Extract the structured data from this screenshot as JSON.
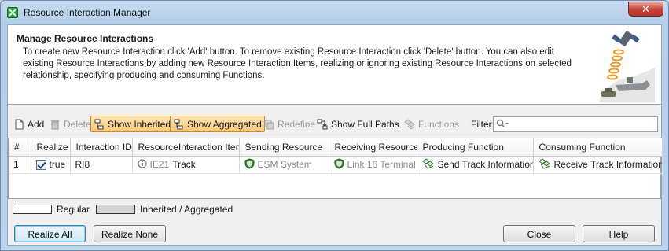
{
  "window": {
    "title": "Resource Interaction Manager",
    "close_glyph": "✕"
  },
  "header": {
    "title": "Manage Resource Interactions",
    "description": "To create new Resource Interaction click 'Add' button. To remove existing Resource Interaction click 'Delete' button. You can also edit existing Resource Interactions by adding new Resource Interaction Items, realizing or ignoring existing Resource Interactions on selected relationship, specifying producing and consuming Functions."
  },
  "toolbar": {
    "add": "Add",
    "delete": "Delete",
    "show_inherited": "Show Inherited",
    "show_aggregated": "Show Aggregated",
    "redefine": "Redefine",
    "show_full_paths": "Show Full Paths",
    "functions": "Functions",
    "filter_label": "Filter:",
    "filter_value": ""
  },
  "table": {
    "headers": [
      "#",
      "Realize",
      "Interaction ID",
      "ResourceInteraction Item",
      "Sending Resource",
      "Receiving Resource",
      "Producing Function",
      "Consuming Function"
    ],
    "rows": [
      {
        "num": "1",
        "realize": "true",
        "interaction_id": "RI8",
        "item_prefix": "IE21",
        "item_name": "Track",
        "sending": "ESM System",
        "receiving": "Link 16 Terminal",
        "producing": "Send Track Information",
        "consuming": "Receive Track Information"
      }
    ]
  },
  "legend": {
    "regular": "Regular",
    "inherited": "Inherited / Aggregated",
    "regular_color": "#ffffff",
    "inherited_color": "#d4d4d4"
  },
  "buttons": {
    "realize_all": "Realize All",
    "realize_none": "Realize None",
    "close": "Close",
    "help": "Help"
  },
  "colors": {
    "toggle_bg": "#f7c77a",
    "icon_green": "#3c8c3c"
  }
}
